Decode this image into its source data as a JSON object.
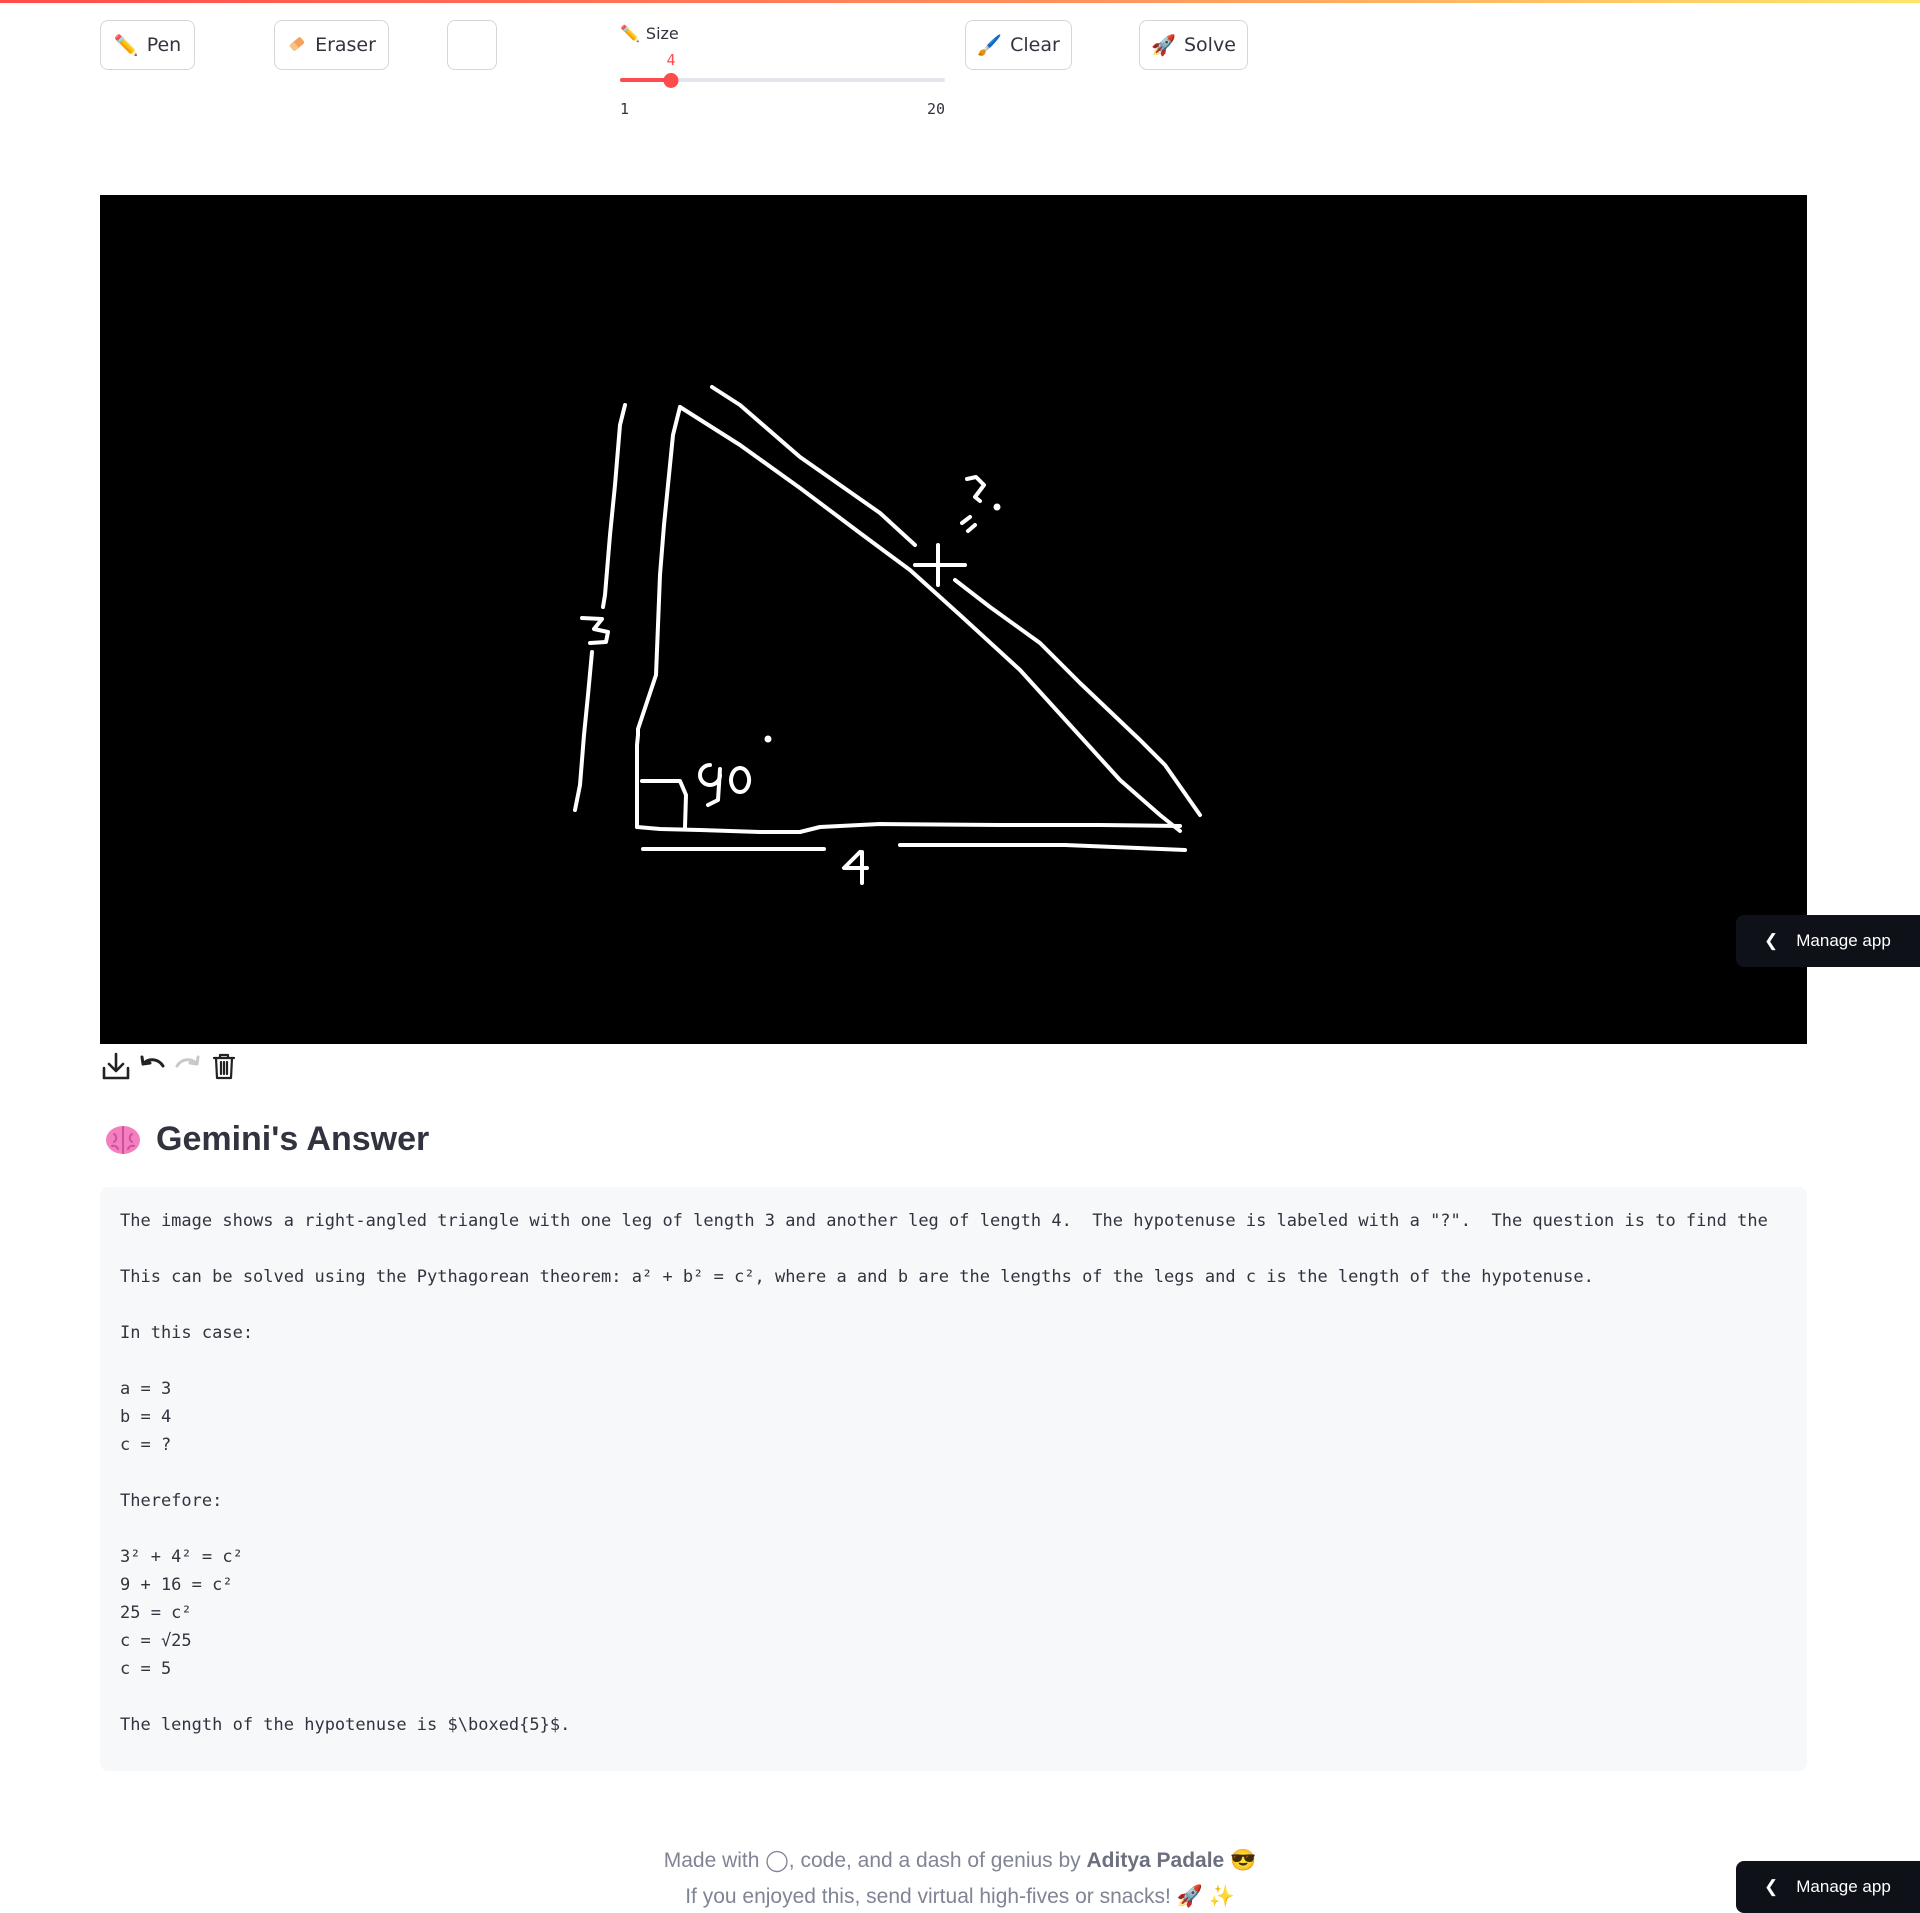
{
  "toolbar": {
    "pen_label": "Pen",
    "eraser_label": "Eraser",
    "clear_label": "Clear",
    "solve_label": "Solve",
    "pen_icon": "pencil-icon",
    "eraser_icon": "eraser-icon",
    "clear_icon": "brush-icon",
    "solve_icon": "rocket-icon"
  },
  "size_slider": {
    "label": "Size",
    "value": "4",
    "min": "1",
    "max": "20",
    "value_num": 4,
    "min_num": 1,
    "max_num": 20
  },
  "canvas": {
    "background": "#000000",
    "stroke_color": "#ffffff",
    "handwritten_labels": [
      "3",
      "4",
      "90°",
      "?"
    ]
  },
  "canvas_tools": [
    "download-icon",
    "undo-icon",
    "redo-icon",
    "trash-icon"
  ],
  "answer": {
    "heading": "Gemini's Answer",
    "lines": [
      "The image shows a right-angled triangle with one leg of length 3 and another leg of length 4.  The hypotenuse is labeled with a \"?\".  The question is to find the",
      "",
      "This can be solved using the Pythagorean theorem: a² + b² = c², where a and b are the lengths of the legs and c is the length of the hypotenuse.",
      "",
      "In this case:",
      "",
      "a = 3",
      "b = 4",
      "c = ?",
      "",
      "Therefore:",
      "",
      "3² + 4² = c²",
      "9 + 16 = c²",
      "25 = c²",
      "c = √25",
      "c = 5",
      "",
      "The length of the hypotenuse is $\\boxed{5}$."
    ]
  },
  "footer": {
    "line1_prefix": "Made with ",
    "line1_middle": ", code, and a dash of genius by ",
    "line1_author": "Aditya Padale",
    "line2": "If you enjoyed this, send virtual high-fives or snacks!"
  },
  "manage_app_label": "Manage app",
  "colors": {
    "accent": "#ff4b4b",
    "answer_bg": "#f7f8fa",
    "manage_bg": "#0e1117"
  }
}
